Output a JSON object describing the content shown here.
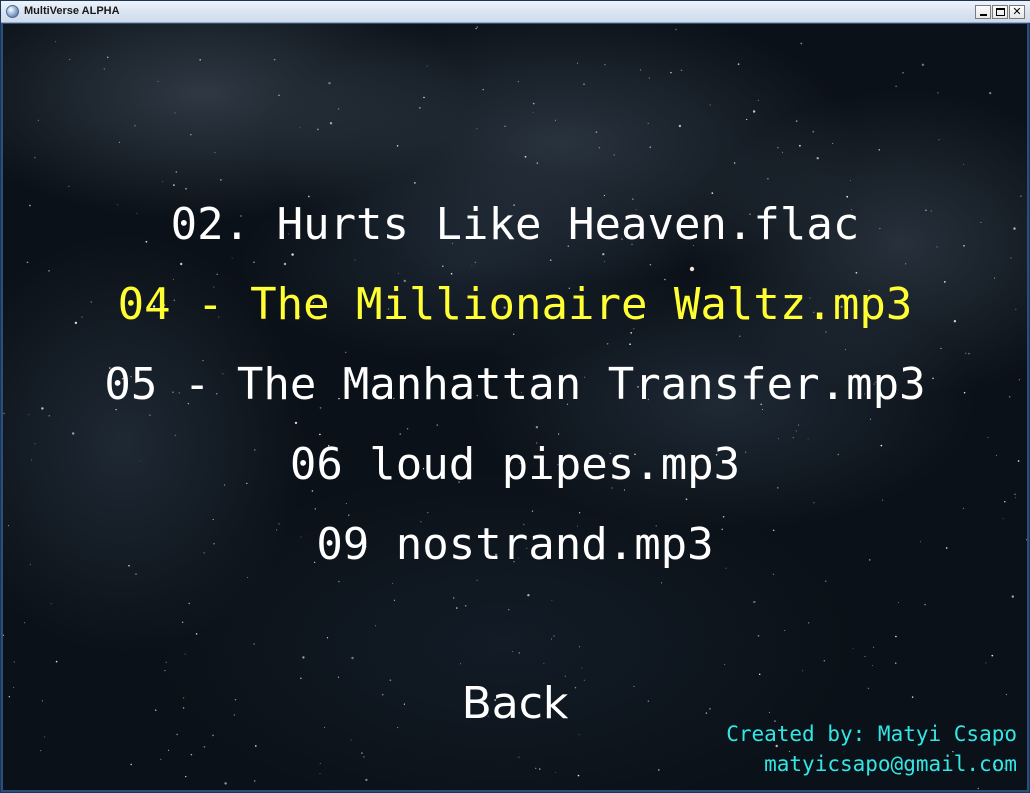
{
  "window": {
    "title": "MultiVerse ALPHA",
    "icon": "app-globe-icon",
    "controls": {
      "minimize": "minimize-icon",
      "maximize": "maximize-icon",
      "close_glyph": "✕"
    }
  },
  "playlist": {
    "selected_index": 1,
    "selected_color": "#ffff33",
    "default_color": "#ffffff",
    "tracks": [
      "02. Hurts Like Heaven.flac",
      "04 - The Millionaire Waltz.mp3",
      "05 - The Manhattan Transfer.mp3",
      "06 loud pipes.mp3",
      "09 nostrand.mp3"
    ]
  },
  "back_label": "Back",
  "credits": {
    "line": "Created by: Matyi Csapo",
    "email": "matyicsapo@gmail.com",
    "color": "#33e6e6"
  }
}
